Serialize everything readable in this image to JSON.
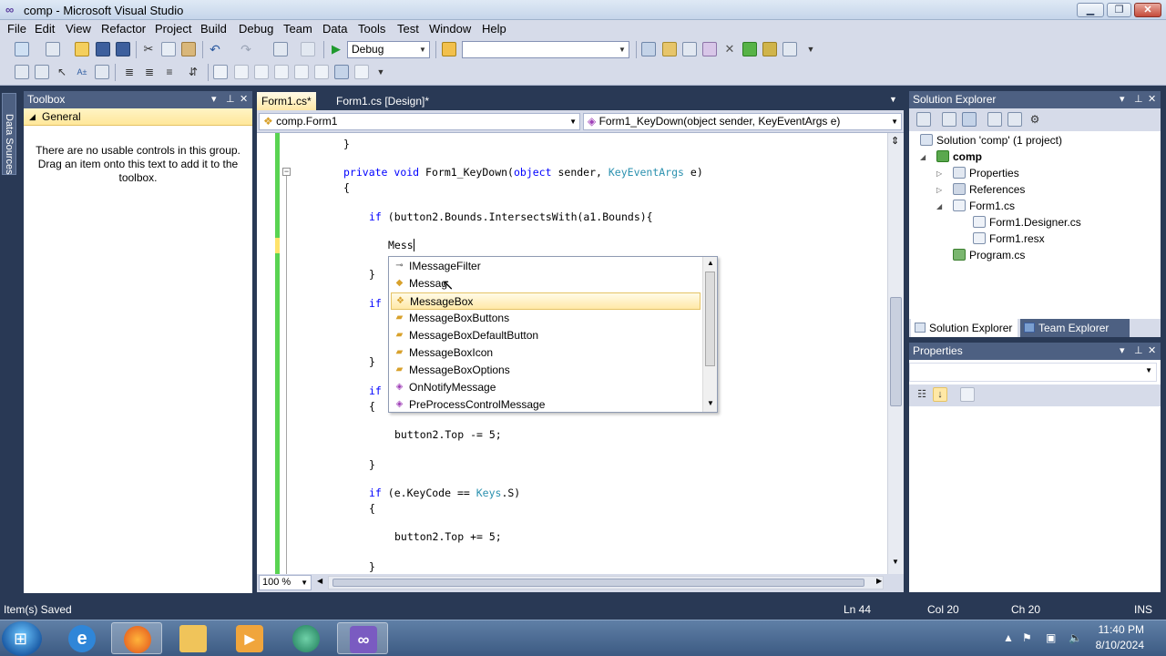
{
  "window": {
    "title": "comp - Microsoft Visual Studio",
    "minimize": "▁",
    "restore": "❐",
    "close": "✕"
  },
  "menu": [
    "File",
    "Edit",
    "View",
    "Refactor",
    "Project",
    "Build",
    "Debug",
    "Team",
    "Data",
    "Tools",
    "Test",
    "Window",
    "Help"
  ],
  "toolbar": {
    "config": "Debug",
    "platform": ""
  },
  "side_tabs": {
    "data_sources": "Data Sources"
  },
  "toolbox": {
    "title": "Toolbox",
    "group": "General",
    "message": "There are no usable controls in this group. Drag an item onto this text to add it to the toolbox."
  },
  "editor": {
    "tabs": [
      {
        "label": "Form1.cs*",
        "active": true
      },
      {
        "label": "Form1.cs [Design]*",
        "active": false
      }
    ],
    "class_nav": "comp.Form1",
    "member_nav": "Form1_KeyDown(object sender, KeyEventArgs e)",
    "zoom": "100 %",
    "code": {
      "l1": "}",
      "l2_kw1": "private",
      "l2_kw2": "void",
      "l2_name": "Form1_KeyDown(",
      "l2_kw3": "object",
      "l2_mid": "sender,",
      "l2_type": "KeyEventArgs",
      "l2_end": "e)",
      "l3": "{",
      "l4_kw": "if",
      "l4_rest": "(button2.Bounds.IntersectsWith(a1.Bounds){",
      "l5": "Mess",
      "l6": "}",
      "l7": "if",
      "l8": "}",
      "l9": "if",
      "l10": "{",
      "l11": "button2.Top -= 5;",
      "l12": "}",
      "l13_kw": "if",
      "l13_a": "(e.KeyCode ==",
      "l13_type": "Keys",
      "l13_b": ".S)",
      "l14": "{",
      "l15": "button2.Top += 5;",
      "l16": "}"
    }
  },
  "intellisense": {
    "items": [
      {
        "label": "IMessageFilter",
        "icon": "interface-icon",
        "glyph": "⊸",
        "color": "#555555",
        "selected": false
      },
      {
        "label": "Messag",
        "icon": "namespace-icon",
        "glyph": "◆",
        "color": "#d8a12c",
        "selected": false
      },
      {
        "label": "MessageBox",
        "icon": "class-icon",
        "glyph": "❖",
        "color": "#d8a12c",
        "selected": true
      },
      {
        "label": "MessageBoxButtons",
        "icon": "enum-icon",
        "glyph": "▰",
        "color": "#d8a12c",
        "selected": false
      },
      {
        "label": "MessageBoxDefaultButton",
        "icon": "enum-icon",
        "glyph": "▰",
        "color": "#d8a12c",
        "selected": false
      },
      {
        "label": "MessageBoxIcon",
        "icon": "enum-icon",
        "glyph": "▰",
        "color": "#d8a12c",
        "selected": false
      },
      {
        "label": "MessageBoxOptions",
        "icon": "enum-icon",
        "glyph": "▰",
        "color": "#d8a12c",
        "selected": false
      },
      {
        "label": "OnNotifyMessage",
        "icon": "method-icon",
        "glyph": "◈",
        "color": "#a040b8",
        "selected": false
      },
      {
        "label": "PreProcessControlMessage",
        "icon": "method-icon",
        "glyph": "◈",
        "color": "#a040b8",
        "selected": false
      }
    ]
  },
  "solution_explorer": {
    "title": "Solution Explorer",
    "solution": "Solution 'comp' (1 project)",
    "project": "comp",
    "items": {
      "properties": "Properties",
      "references": "References",
      "form1": "Form1.cs",
      "designer": "Form1.Designer.cs",
      "resx": "Form1.resx",
      "program": "Program.cs"
    },
    "tabs": [
      "Solution Explorer",
      "Team Explorer"
    ]
  },
  "properties": {
    "title": "Properties"
  },
  "status": {
    "message": "Item(s) Saved",
    "line": "Ln 44",
    "col": "Col 20",
    "ch": "Ch 20",
    "mode": "INS"
  },
  "taskbar": {
    "time": "11:40 PM",
    "date": "8/10/2024"
  },
  "colors": {
    "vs_chrome": "#293955",
    "keyword": "#0000ff",
    "type": "#2b91af",
    "selection": "#ffe8a6"
  }
}
